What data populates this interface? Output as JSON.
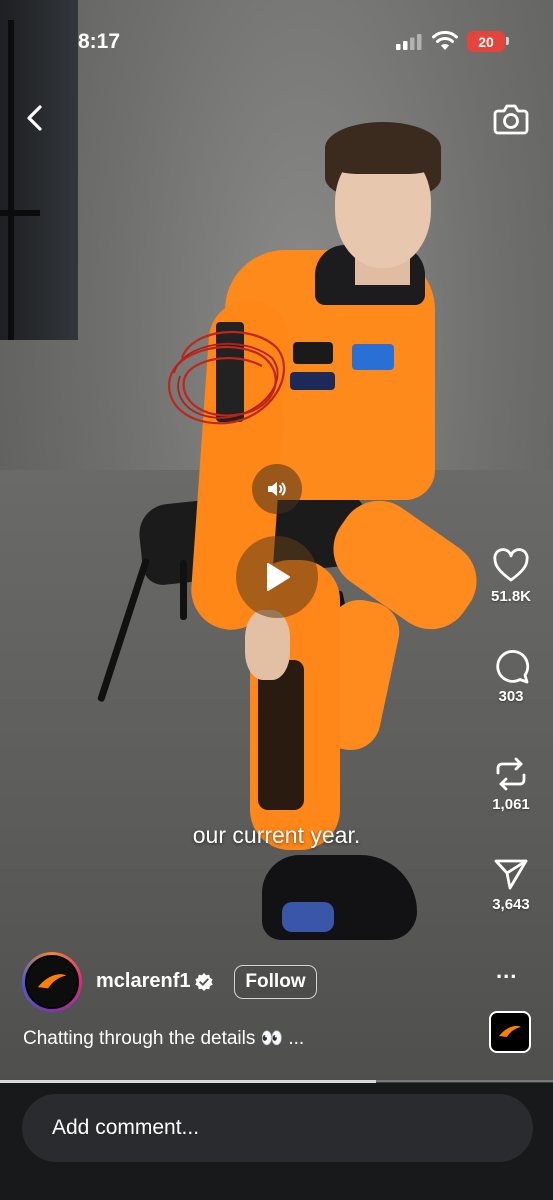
{
  "status_bar": {
    "time": "8:17",
    "battery": "20"
  },
  "video": {
    "caption": "our current year.",
    "progress": 0.68
  },
  "actions": {
    "likes": "51.8K",
    "comments": "303",
    "reposts": "1,061",
    "shares": "3,643"
  },
  "author": {
    "username": "mclarenf1",
    "follow_label": "Follow"
  },
  "post": {
    "description": "Chatting through the details",
    "description_emoji": "👀",
    "more": "..."
  },
  "comment_bar": {
    "placeholder": "Add comment..."
  },
  "colors": {
    "accent_orange": "#ff8a1c",
    "battery_red": "#e3443b",
    "bar_bg": "#18191b",
    "field_bg": "#2a2b2e"
  }
}
